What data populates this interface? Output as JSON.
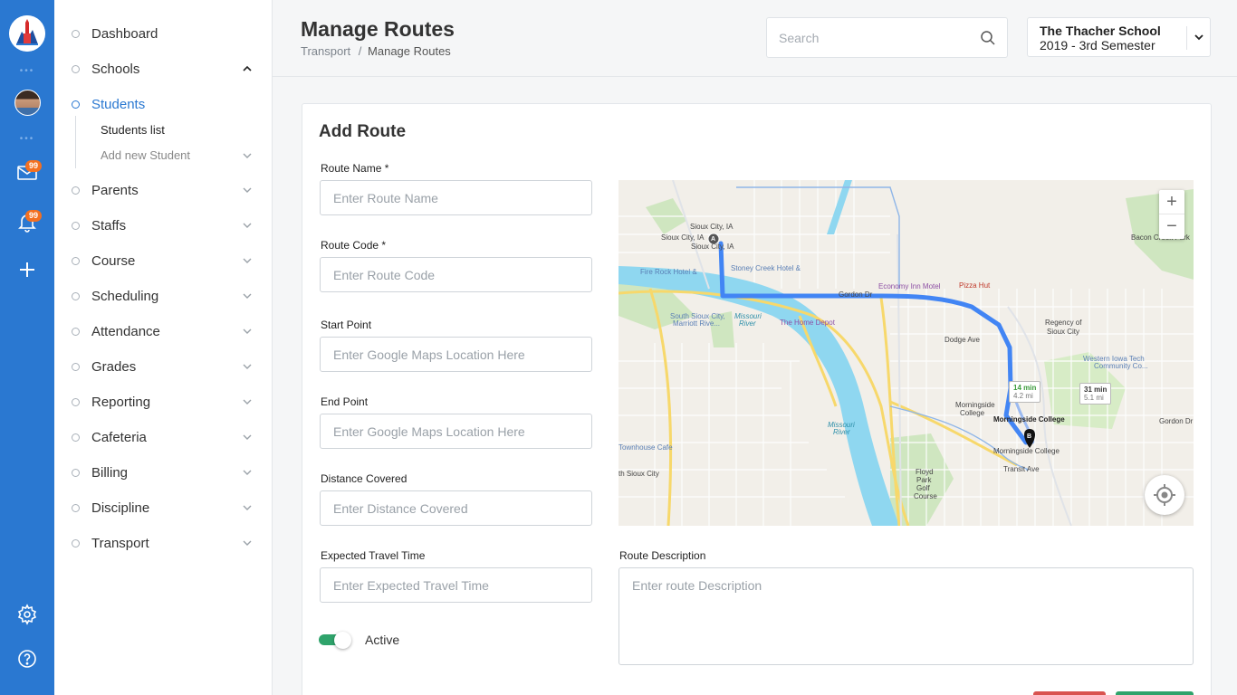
{
  "app": {
    "logo_icon": "school-logo",
    "accent_color": "#2a78d1",
    "badge_color": "#f37021"
  },
  "rail": {
    "mail_badge": "99",
    "notifications_badge": "99",
    "icons": [
      "mail-icon",
      "bell-icon",
      "plus-icon",
      "gear-icon",
      "help-icon"
    ]
  },
  "sidebar": {
    "items": [
      {
        "label": "Dashboard"
      },
      {
        "label": "Schools"
      },
      {
        "label": "Students"
      },
      {
        "label": "Parents"
      },
      {
        "label": "Staffs"
      },
      {
        "label": "Course"
      },
      {
        "label": "Scheduling"
      },
      {
        "label": "Attendance"
      },
      {
        "label": "Grades"
      },
      {
        "label": "Reporting"
      },
      {
        "label": "Cafeteria"
      },
      {
        "label": "Billing"
      },
      {
        "label": "Discipline"
      },
      {
        "label": "Transport"
      }
    ],
    "students_sub": {
      "list": "Students list",
      "add": "Add new Student"
    }
  },
  "header": {
    "title": "Manage Routes",
    "breadcrumb_parent": "Transport",
    "breadcrumb_sep": "/",
    "breadcrumb_current": "Manage Routes",
    "search_placeholder": "Search",
    "school_name": "The Thacher School",
    "school_term": "2019 - 3rd Semester"
  },
  "form": {
    "title": "Add Route",
    "route_name": {
      "label": "Route Name *",
      "placeholder": "Enter Route Name",
      "value": ""
    },
    "route_code": {
      "label": "Route Code *",
      "placeholder": "Enter Route Code",
      "value": ""
    },
    "start_point": {
      "label": "Start Point",
      "placeholder": "Enter Google Maps Location Here",
      "value": ""
    },
    "end_point": {
      "label": "End Point",
      "placeholder": "Enter Google Maps Location Here",
      "value": ""
    },
    "distance": {
      "label": "Distance Covered",
      "placeholder": "Enter Distance Covered",
      "value": ""
    },
    "travel_time": {
      "label": "Expected Travel Time",
      "placeholder": "Enter Expected Travel Time",
      "value": ""
    },
    "description": {
      "label": "Route Description",
      "placeholder": "Enter route Description",
      "value": ""
    },
    "active_label": "Active",
    "active": true
  },
  "map": {
    "zoom_in": "+",
    "zoom_out": "−",
    "labels": {
      "sioux_city_1": "Sioux City, IA",
      "sioux_city_2": "Sioux City, IA",
      "sioux_city_3": "Sioux City, IA",
      "south_sioux": "South Sioux City,",
      "marriott": "Marriott Rive...",
      "missouri_river_1": "Missouri",
      "missouri_river_1b": "River",
      "missouri_river_2": "Missouri",
      "missouri_river_2b": "River",
      "home_depot": "The Home Depot",
      "pizza_hut": "Pizza Hut",
      "economy_inn": "Economy Inn Motel",
      "regency_1": "Regency of",
      "regency_2": "Sioux City",
      "western_iowa_1": "Western Iowa Tech",
      "western_iowa_2": "Community Co...",
      "bacon_creek": "Bacon Creek Park",
      "morningside_college_1": "Morningside",
      "morningside_college_1b": "College",
      "morningside_college_bold": "Morningside College",
      "morningside_college_2": "Morningside College",
      "floyd_1": "Floyd",
      "floyd_2": "Park",
      "floyd_3": "Golf",
      "floyd_4": "Course",
      "sioux_city_sw": "th Sioux City",
      "townhouse": "Townhouse Cafe",
      "dodge_ave": "Dodge Ave",
      "gordon_dr_1": "Gordon Dr",
      "gordon_dr_2": "Gordon Dr",
      "transit_ave": "Transit Ave",
      "fire_rock": "Fire Rock Hotel &",
      "stoney_creek": "Stoney Creek Hotel &",
      "marker_a": "A",
      "marker_b": "B"
    },
    "eta_car": {
      "time": "14 min",
      "distance": "4.2 mi"
    },
    "eta_bus": {
      "time": "31 min",
      "distance": "5.1 mi"
    }
  }
}
